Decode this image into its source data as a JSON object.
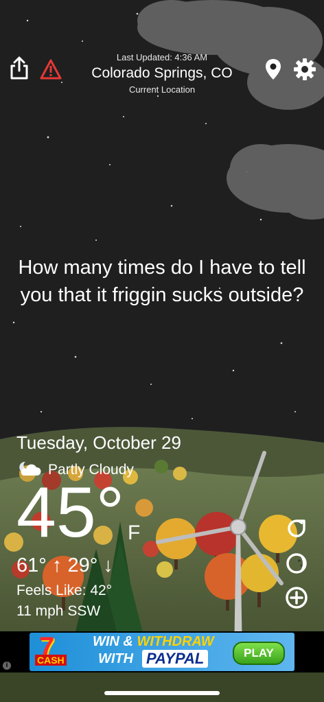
{
  "header": {
    "last_updated": "Last Updated: 4:36 AM",
    "city": "Colorado Springs, CO",
    "location_label": "Current Location",
    "icons": [
      "share-icon",
      "alert-icon",
      "location-pin-icon",
      "gear-icon"
    ]
  },
  "message": "How many times do I have to tell you that it friggin sucks outside?",
  "weather": {
    "date": "Tuesday, October 29",
    "condition": "Partly Cloudy",
    "condition_icon": "partly-cloudy-night-icon",
    "temperature": "45°",
    "unit": "F",
    "hi_lo": "61° ↑ 29° ↓",
    "feels_like": "Feels Like: 42°",
    "wind": "11 mph SSW"
  },
  "side_buttons": [
    "refresh-icon",
    "moon-phase-icon",
    "add-icon"
  ],
  "ad": {
    "seven": "7",
    "cash": "CASH",
    "line1_a": "WIN &",
    "line1_b": "WITHDRAW",
    "line2": "WITH",
    "paypal": "PAYPAL",
    "play": "PLAY",
    "info": "i"
  },
  "colors": {
    "sky": "#1f1f20",
    "cloud": "#6b6b6b",
    "hill_far": "#5d6b44",
    "hill_near": "#3d4a2a",
    "accent_ad": "#1e8fd8"
  }
}
